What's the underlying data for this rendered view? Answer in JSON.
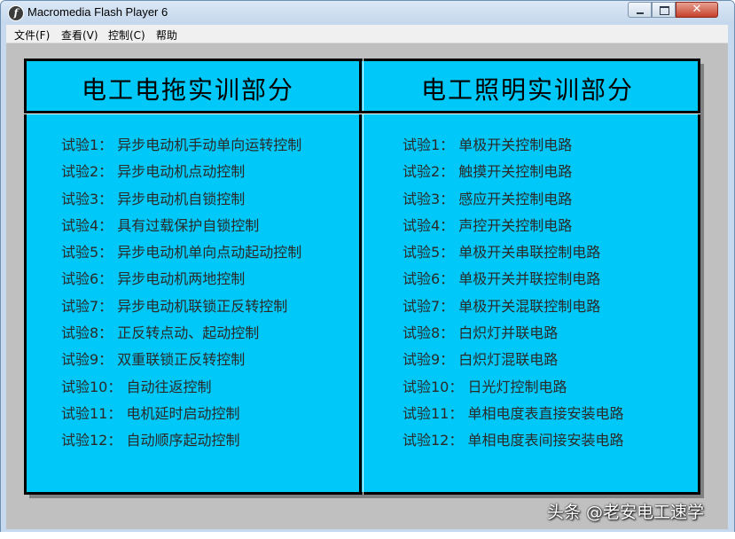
{
  "window": {
    "title": "Macromedia Flash Player 6",
    "icon": "flash-icon",
    "controls": {
      "minimize": "minimize-icon",
      "maximize": "maximize-icon",
      "close": "✕"
    }
  },
  "menu": [
    "文件(F)",
    "查看(V)",
    "控制(C)",
    "帮助"
  ],
  "left_panel": {
    "title": "电工电拖实训部分",
    "items": [
      "试验1：  异步电动机手动单向运转控制",
      "试验2：  异步电动机点动控制",
      "试验3：  异步电动机自锁控制",
      "试验4：  具有过载保护自锁控制",
      "试验5：  异步电动机单向点动起动控制",
      "试验6：  异步电动机两地控制",
      "试验7：  异步电动机联锁正反转控制",
      "试验8：  正反转点动、起动控制",
      "试验9：  双重联锁正反转控制",
      "试验10：  自动往返控制",
      "试验11：  电机延时启动控制",
      "试验12：  自动顺序起动控制"
    ]
  },
  "right_panel": {
    "title": "电工照明实训部分",
    "items": [
      "试验1：  单极开关控制电路",
      "试验2：  触摸开关控制电路",
      "试验3：  感应开关控制电路",
      "试验4：  声控开关控制电路",
      "试验5：  单极开关串联控制电路",
      "试验6：  单极开关并联控制电路",
      "试验7：  单极开关混联控制电路",
      "试验8：  白炽灯并联电路",
      "试验9：  白炽灯混联电路",
      "试验10：  日光灯控制电路",
      "试验11：  单相电度表直接安装电路",
      "试验12：  单相电度表间接安装电路"
    ]
  },
  "watermark": "头条 @老安电工速学",
  "colors": {
    "board": "#00c8f8",
    "border": "#000000",
    "client": "#c0c0c0"
  }
}
